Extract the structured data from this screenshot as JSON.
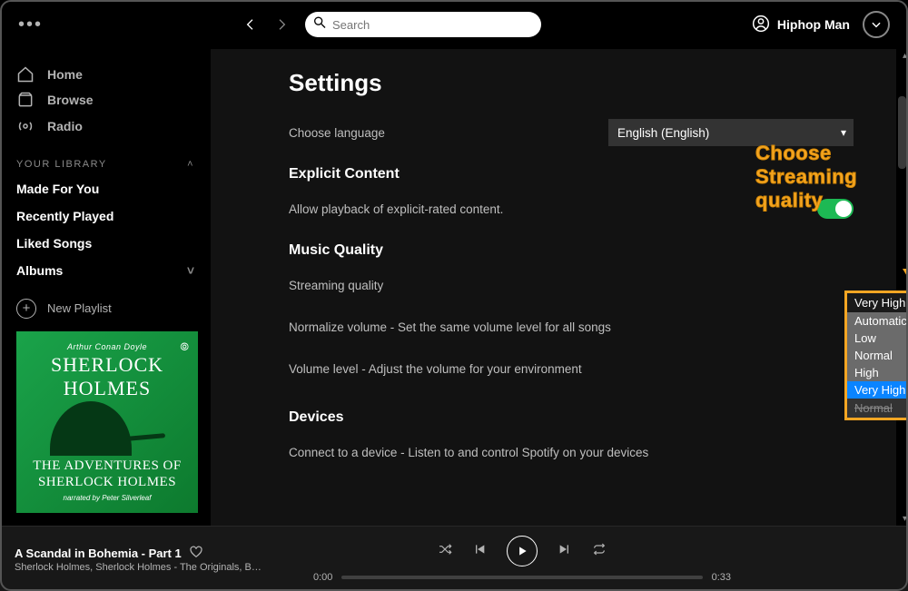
{
  "header": {
    "search_placeholder": "Search",
    "username": "Hiphop Man"
  },
  "sidebar": {
    "nav": [
      {
        "label": "Home"
      },
      {
        "label": "Browse"
      },
      {
        "label": "Radio"
      }
    ],
    "library_header": "YOUR LIBRARY",
    "library": [
      {
        "label": "Made For You"
      },
      {
        "label": "Recently Played"
      },
      {
        "label": "Liked Songs"
      },
      {
        "label": "Albums"
      }
    ],
    "new_playlist": "New Playlist",
    "cover": {
      "author": "Arthur Conan Doyle",
      "title_top": "SHERLOCK\nHOLMES",
      "title_bottom": "THE ADVENTURES OF\nSHERLOCK HOLMES",
      "narrator": "narrated by Peter Silverleaf"
    }
  },
  "settings": {
    "page_title": "Settings",
    "language_label": "Choose language",
    "language_value": "English (English)",
    "explicit": {
      "heading": "Explicit Content",
      "label": "Allow playback of explicit-rated content.",
      "value": true
    },
    "music_quality": {
      "heading": "Music Quality",
      "streaming_label": "Streaming quality",
      "streaming_value": "Very High",
      "streaming_options": [
        "Automatic",
        "Low",
        "Normal",
        "High",
        "Very High"
      ],
      "normalize_label": "Normalize volume - Set the same volume level for all songs",
      "volume_level_label": "Volume level - Adjust the volume for your environment",
      "volume_level_hidden": "Normal"
    },
    "devices": {
      "heading": "Devices",
      "connect_label": "Connect to a device - Listen to and control Spotify on your devices"
    }
  },
  "player": {
    "track_title": "A Scandal in Bohemia - Part 1",
    "track_subtitle": "Sherlock Holmes, Sherlock Holmes - The Originals, B…",
    "elapsed": "0:00",
    "total": "0:33"
  },
  "annotation": {
    "text": "Choose Streaming quality"
  }
}
